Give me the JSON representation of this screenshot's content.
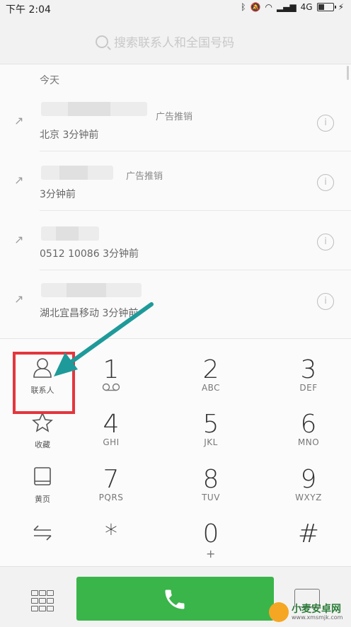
{
  "status_bar": {
    "time": "下午 2:04",
    "network": "4G"
  },
  "search": {
    "placeholder": "搜索联系人和全国号码"
  },
  "call_log": {
    "section": "今天",
    "entries": [
      {
        "tag": "广告推销",
        "detail": "北京 3分钟前",
        "icon": "outgoing-call-icon"
      },
      {
        "tag": "广告推销",
        "detail": "3分钟前",
        "icon": "outgoing-call-icon"
      },
      {
        "tag": "",
        "detail": "0512 10086 3分钟前",
        "icon": "outgoing-call-icon"
      },
      {
        "tag": "",
        "detail": "湖北宜昌移动 3分钟前",
        "icon": "outgoing-call-icon"
      }
    ],
    "info_symbol": "i"
  },
  "keypad": {
    "side": [
      {
        "label": "联系人",
        "icon": "contacts-icon"
      },
      {
        "label": "收藏",
        "icon": "star-icon"
      },
      {
        "label": "黄页",
        "icon": "yellow-pages-icon"
      },
      {
        "label": "",
        "icon": "swap-arrows-icon"
      }
    ],
    "keys": [
      {
        "digit": "1",
        "letters": ""
      },
      {
        "digit": "2",
        "letters": "ABC"
      },
      {
        "digit": "3",
        "letters": "DEF"
      },
      {
        "digit": "4",
        "letters": "GHI"
      },
      {
        "digit": "5",
        "letters": "JKL"
      },
      {
        "digit": "6",
        "letters": "MNO"
      },
      {
        "digit": "7",
        "letters": "PQRS"
      },
      {
        "digit": "8",
        "letters": "TUV"
      },
      {
        "digit": "9",
        "letters": "WXYZ"
      },
      {
        "digit": "*",
        "letters": ""
      },
      {
        "digit": "0",
        "letters": "+"
      },
      {
        "digit": "#",
        "letters": ""
      }
    ]
  },
  "bottom_bar": {
    "call_color": "#3ab54a"
  },
  "annotation": {
    "highlight_color": "#e4363d",
    "arrow_color": "#1e9a9a"
  },
  "watermark": {
    "name": "小麦安卓网",
    "url": "www.xmsmjk.com"
  }
}
